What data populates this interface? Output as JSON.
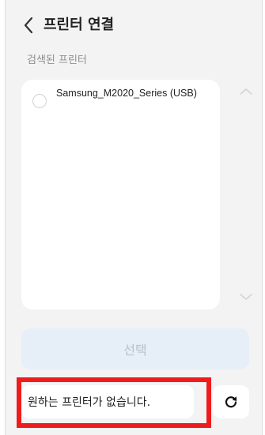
{
  "header": {
    "title": "프린터 연결",
    "back_icon": "chevron-left-icon"
  },
  "section": {
    "label": "검색된 프린터"
  },
  "printers": [
    {
      "name": "Samsung_M2020_Series (USB)",
      "selected": false
    }
  ],
  "buttons": {
    "select_label": "선택",
    "no_printer_label": "원하는 프린터가 없습니다.",
    "refresh_icon": "refresh-icon"
  },
  "colors": {
    "background": "#f3f3f3",
    "card": "#ffffff",
    "select_button_bg": "#e6eef7",
    "select_button_text": "#b7c2cc",
    "highlight": "#ee1c1c"
  }
}
